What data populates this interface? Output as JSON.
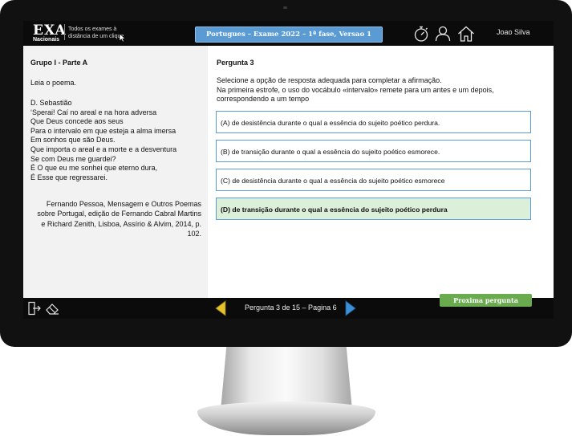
{
  "header": {
    "logo_main": "EXA",
    "logo_sub": "Nacionais",
    "tagline": "Todos os exames à distância de um clique",
    "exam_title": "Portugues – Exame 2022 – 1ª fase, Versao 1",
    "user_name": "Joao Silva",
    "icons": [
      "stopwatch-icon",
      "user-icon",
      "home-icon"
    ]
  },
  "left_panel": {
    "group_title": "Grupo I - Parte A",
    "intro": "Leia o poema.",
    "poem_lines": [
      "D. Sebastião",
      "‘Sperai! Caí no areal e na hora adversa",
      "Que Deus concede aos seus",
      "Para o intervalo em que esteja a alma imersa",
      "Em sonhos que são Deus.",
      "Que importa o areal e a morte e a desventura",
      "Se com Deus me guardei?",
      "É O que eu me sonhei que eterno dura,",
      "É Esse que regressarei."
    ],
    "source": "Fernando Pessoa, Mensagem e Outros Poemas sobre Portugal, edição de Fernando Cabral Martins e Richard Zenith, Lisboa, Assírio & Alvim, 2014, p. 102."
  },
  "question": {
    "title": "Pergunta 3",
    "text_line1": "Selecione a opção de resposta adequada para completar a afirmação.",
    "text_line2": "Na primeira estrofe, o uso do vocábulo «intervalo» remete para um antes e um depois, correspondendo a um tempo",
    "options": [
      {
        "label": "(A) de desistência durante o qual a essência do sujeito poético perdura.",
        "selected": false
      },
      {
        "label": "(B) de transição durante o qual a essência do sujeito poético esmorece.",
        "selected": false
      },
      {
        "label": "(C) de desistência durante o qual a essência do sujeito poético esmorece",
        "selected": false
      },
      {
        "label": "(D) de transição durante o qual a essência do sujeito poético perdura",
        "selected": true
      }
    ]
  },
  "footer": {
    "pager": "Pergunta 3 de 15 – Pagina 6",
    "next_button": "Proxima pergunta",
    "icons": [
      "exit-icon",
      "eraser-icon",
      "prev-arrow-icon",
      "next-arrow-icon"
    ]
  },
  "colors": {
    "title_bar_blue": "#5a9bd4",
    "option_border": "#5b9bd5",
    "selected_option_bg": "#dcefd9",
    "next_button_green": "#6aab4f",
    "arrow_yellow": "#e6c12a",
    "arrow_blue": "#3d8fd8"
  }
}
